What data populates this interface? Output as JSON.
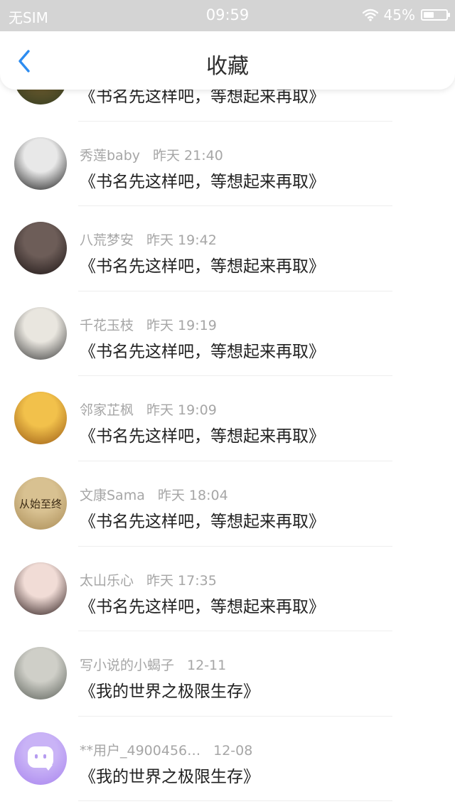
{
  "status_bar": {
    "carrier": "无SIM",
    "time": "09:59",
    "battery_text": "45%",
    "battery_level": 0.45
  },
  "header": {
    "title": "收藏",
    "back_icon": "chevron-left-icon",
    "accent": "#2d8cf0"
  },
  "items": [
    {
      "username": "",
      "time": "",
      "title": "《书名先这样吧，等想起来再取》",
      "avatar_colors": [
        "#6b5a2e",
        "#2e3a1f"
      ]
    },
    {
      "username": "秀莲baby",
      "time": "昨天 21:40",
      "title": "《书名先这样吧，等想起来再取》",
      "avatar_colors": [
        "#e8e8e8",
        "#1a1a1a"
      ]
    },
    {
      "username": "八荒梦安",
      "time": "昨天 19:42",
      "title": "《书名先这样吧，等想起来再取》",
      "avatar_colors": [
        "#6d5d58",
        "#1c1414"
      ]
    },
    {
      "username": "千花玉枝",
      "time": "昨天 19:19",
      "title": "《书名先这样吧，等想起来再取》",
      "avatar_colors": [
        "#e9e6df",
        "#3a3a3a"
      ]
    },
    {
      "username": "邻家芷枫",
      "time": "昨天 19:09",
      "title": "《书名先这样吧，等想起来再取》",
      "avatar_colors": [
        "#f2c14b",
        "#9a5a14"
      ]
    },
    {
      "username": "文康Sama",
      "time": "昨天 18:04",
      "title": "《书名先这样吧，等想起来再取》",
      "avatar_colors": [
        "#d8c191",
        "#a98b55"
      ],
      "avatar_text": "从始至终"
    },
    {
      "username": "太山乐心",
      "time": "昨天 17:35",
      "title": "《书名先这样吧，等想起来再取》",
      "avatar_colors": [
        "#f1dcd6",
        "#2a1a1a"
      ]
    },
    {
      "username": "写小说的小蝎子",
      "time": "12-11",
      "title": "《我的世界之极限生存》",
      "avatar_colors": [
        "#cfcfc8",
        "#5a5f58"
      ]
    },
    {
      "username": "**用户_4900456…",
      "time": "12-08",
      "title": "《我的世界之极限生存》",
      "avatar_colors": [
        "#c9b3f6",
        "#a884ee"
      ]
    }
  ]
}
